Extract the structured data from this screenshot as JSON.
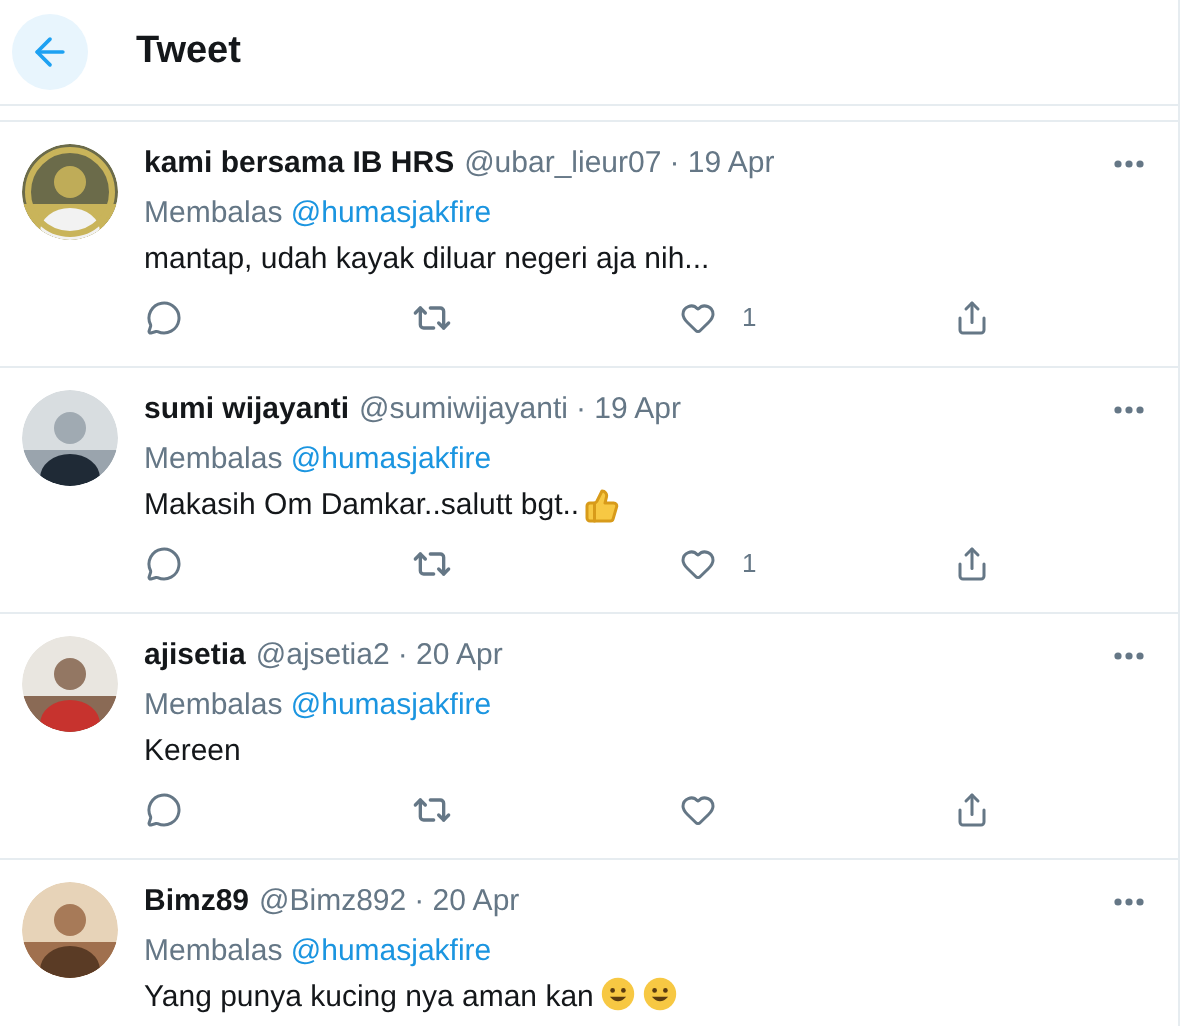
{
  "header": {
    "title": "Tweet"
  },
  "tweets": [
    {
      "name": "kami bersama IB HRS",
      "handle": "@ubar_lieur07",
      "date": "· 19 Apr",
      "reply_prefix": "Membalas",
      "reply_to": "@humasjakfire",
      "text": "mantap, udah kayak diluar negeri aja nih...",
      "like_count": "1"
    },
    {
      "name": "sumi wijayanti",
      "handle": "@sumiwijayanti",
      "date": "· 19 Apr",
      "reply_prefix": "Membalas",
      "reply_to": "@humasjakfire",
      "text": "Makasih Om Damkar..salutt bgt..",
      "emoji": [
        {
          "kind": "thumbs_up"
        }
      ],
      "like_count": "1"
    },
    {
      "name": "ajisetia",
      "handle": "@ajsetia2",
      "date": "· 20 Apr",
      "reply_prefix": "Membalas",
      "reply_to": "@humasjakfire",
      "text": "Kereen"
    },
    {
      "name": "Bimz89",
      "handle": "@Bimz892",
      "date": "· 20 Apr",
      "reply_prefix": "Membalas",
      "reply_to": "@humasjakfire",
      "text": "Yang punya kucing nya aman kan",
      "emoji": [
        {
          "kind": "smile"
        },
        {
          "kind": "smile"
        }
      ],
      "cut": true
    }
  ]
}
